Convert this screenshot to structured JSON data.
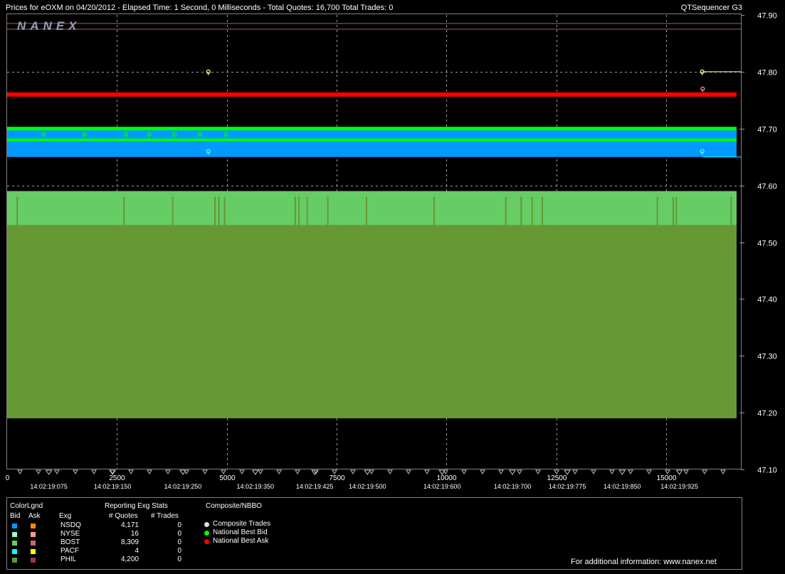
{
  "header": {
    "left_text": "Prices for  eOXM  on  04/20/2012  -  Elapsed Time: 1 Second, 0 Milliseconds  -  Total Quotes: 16,700  Total Trades: 0",
    "right_text": "QTSequencer G3"
  },
  "logo": {
    "text": "NANEX"
  },
  "colors": {
    "bg": "#000000",
    "grid": "#9a9a9a",
    "nsdq_bid": "#0099ff",
    "nsdq_ask": "#ff8c00",
    "nyse_bid": "#99ffcc",
    "nyse_ask": "#ff9999",
    "bost_bid": "#66cc66",
    "bost_ask": "#cc6666",
    "pacf_bid": "#00ffff",
    "pacf_ask": "#ffff00",
    "phil_bid": "#669933",
    "phil_ask": "#993366",
    "nbb": "#00ff00",
    "nba": "#ff0000"
  },
  "chart_data": {
    "type": "area",
    "xlim": [
      0,
      16700
    ],
    "ylim": [
      47.1,
      47.9
    ],
    "grid": true,
    "y_ticks": [
      "47.90",
      "47.80",
      "47.70",
      "47.60",
      "47.50",
      "47.40",
      "47.30",
      "47.20",
      "47.10"
    ],
    "y_tick_values": [
      47.9,
      47.8,
      47.7,
      47.6,
      47.5,
      47.4,
      47.3,
      47.2,
      47.1
    ],
    "x_ticks": [
      "0",
      "2500",
      "5000",
      "7500",
      "10000",
      "12500",
      "15000"
    ],
    "x_tick_values": [
      0,
      2500,
      5000,
      7500,
      10000,
      12500,
      15000
    ],
    "time_labels": [
      "14:02:19:075",
      "14:02:19:150",
      "14:02:19:250",
      "14:02:19:350",
      "14:02:19:425",
      "14:02:19:500",
      "14:02:19:600",
      "14:02:19:700",
      "14:02:19:775",
      "14:02:19:850",
      "14:02:19:925"
    ],
    "time_label_x": [
      950,
      2400,
      4000,
      5650,
      7000,
      8200,
      9900,
      11500,
      12750,
      14000,
      15300
    ],
    "bands": [
      {
        "name": "PHIL bid",
        "color": "#669933",
        "low": 47.19,
        "high": 47.53,
        "x0": 0,
        "x1": 16700
      },
      {
        "name": "BOST bid",
        "color": "#66cc66",
        "low": 47.53,
        "high": 47.59,
        "x0": 0,
        "x1": 16700
      },
      {
        "name": "NSDQ bid",
        "color": "#0099ff",
        "low": 47.65,
        "high": 47.7,
        "x0": 0,
        "x1": 16700
      }
    ],
    "nbbo_lines": [
      {
        "name": "National Best Ask",
        "color": "#ff0000",
        "y": 47.76,
        "x0": 0,
        "x1": 16700,
        "width": 6
      },
      {
        "name": "National Best Bid",
        "color": "#00ff00",
        "y": 47.7,
        "x0": 0,
        "x1": 16700,
        "width": 5
      },
      {
        "name": "National Best Bid",
        "color": "#00ff00",
        "y": 47.68,
        "x0": 0,
        "x1": 16700,
        "width": 4
      }
    ],
    "bost_spikes_x": [
      230,
      2660,
      3770,
      4730,
      4820,
      4950,
      6560,
      6640,
      6830,
      7300,
      8180,
      9720,
      11350,
      11700,
      11950,
      12180,
      14800,
      15160,
      15230,
      16480
    ],
    "markers": [
      {
        "x": 830,
        "y": 47.69,
        "color": "#00ff00"
      },
      {
        "x": 1760,
        "y": 47.69,
        "color": "#00ff00"
      },
      {
        "x": 2710,
        "y": 47.69,
        "color": "#00ff00"
      },
      {
        "x": 3230,
        "y": 47.69,
        "color": "#00ff00"
      },
      {
        "x": 3810,
        "y": 47.69,
        "color": "#00ff00"
      },
      {
        "x": 4390,
        "y": 47.69,
        "color": "#00ff00"
      },
      {
        "x": 4980,
        "y": 47.69,
        "color": "#00ff00"
      },
      {
        "x": 4580,
        "y": 47.8,
        "color": "#ffff99"
      },
      {
        "x": 4580,
        "y": 47.66,
        "color": "#66ffff"
      },
      {
        "x": 15820,
        "y": 47.8,
        "color": "#ffff99"
      },
      {
        "x": 15830,
        "y": 47.77,
        "color": "#ff9999"
      },
      {
        "x": 15820,
        "y": 47.66,
        "color": "#66ffff"
      }
    ],
    "right_ticks": [
      {
        "x0": 15830,
        "y": 47.8,
        "color": "#ffffcc"
      },
      {
        "x0": 15830,
        "y": 47.65,
        "color": "#00ffff"
      }
    ]
  },
  "legend": {
    "colorlgnd_title": "ColorLgnd",
    "bid_header": "Bid",
    "ask_header": "Ask",
    "exg_header": "Exg",
    "stats_title": "Reporting Exg Stats",
    "quotes_header": "# Quotes",
    "trades_header": "# Trades",
    "composite_title": "Composite/NBBO",
    "rows": [
      {
        "exg": "NSDQ",
        "quotes": "4,171",
        "trades": "0",
        "bid": "#0099ff",
        "ask": "#ff8c00"
      },
      {
        "exg": "NYSE",
        "quotes": "16",
        "trades": "0",
        "bid": "#99ffcc",
        "ask": "#ff9999"
      },
      {
        "exg": "BOST",
        "quotes": "8,309",
        "trades": "0",
        "bid": "#66cc66",
        "ask": "#cc6666"
      },
      {
        "exg": "PACF",
        "quotes": "4",
        "trades": "0",
        "bid": "#00ffff",
        "ask": "#ffff00"
      },
      {
        "exg": "PHIL",
        "quotes": "4,200",
        "trades": "0",
        "bid": "#669933",
        "ask": "#993366"
      }
    ],
    "composite_items": [
      {
        "label": "Composite Trades",
        "color": "#dddddd"
      },
      {
        "label": "National Best Bid",
        "color": "#00ff00"
      },
      {
        "label": "National Best Ask",
        "color": "#ff0000"
      }
    ],
    "footer": "For additional information: www.nanex.net"
  }
}
